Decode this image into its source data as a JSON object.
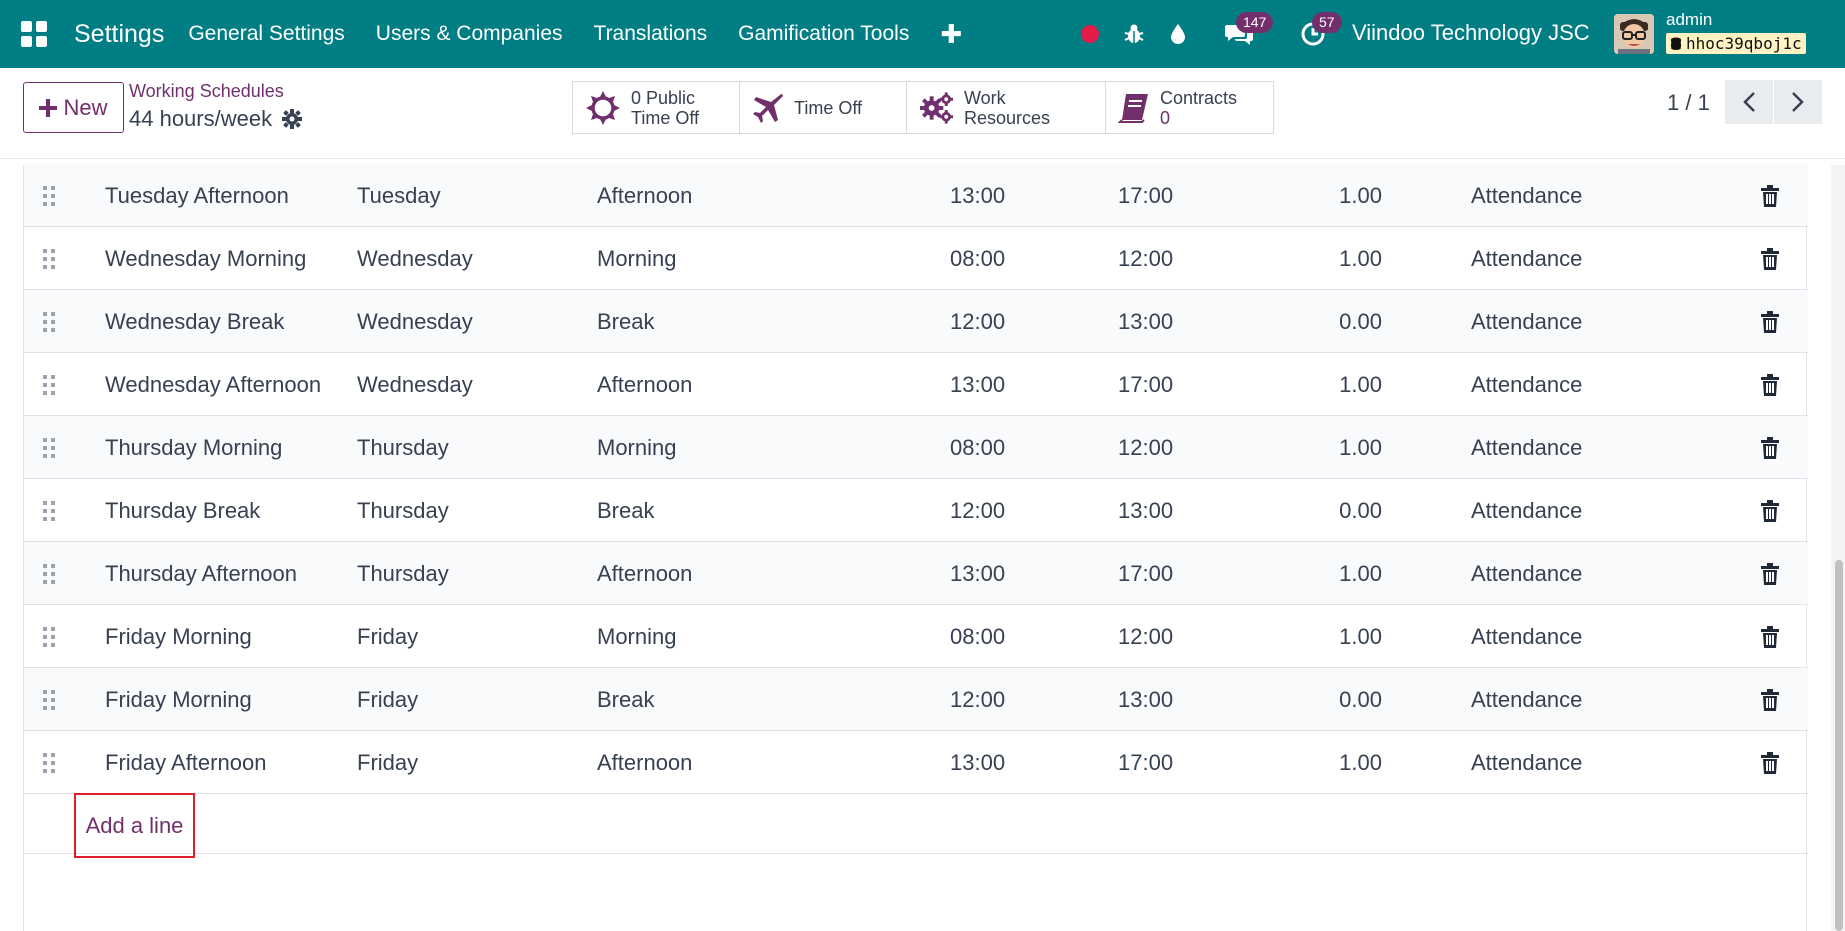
{
  "navbar": {
    "app_title": "Settings",
    "menus": [
      "General Settings",
      "Users & Companies",
      "Translations",
      "Gamification Tools"
    ],
    "plus_label": "✚",
    "messages_count": "147",
    "activities_count": "57",
    "company": "Viindoo Technology JSC",
    "user_name": "admin",
    "db_name": "hhoc39qboj1c",
    "colors": {
      "bar": "#017e84",
      "badge": "#71306b",
      "record_dot": "#e11d48"
    }
  },
  "control": {
    "new_label": "New",
    "breadcrumb": "Working Schedules",
    "record_name": "44 hours/week",
    "smart_buttons": [
      {
        "icon": "sun-icon",
        "line1": "0 Public",
        "line2": "Time Off"
      },
      {
        "icon": "plane-icon",
        "line1": "Time Off",
        "line2": ""
      },
      {
        "icon": "cogs-icon",
        "line1": "Work Resources",
        "line2": ""
      },
      {
        "icon": "book-icon",
        "line1": "Contracts",
        "line2": "0"
      }
    ],
    "pager": "1 / 1"
  },
  "list": {
    "rows": [
      {
        "name": "Tuesday Afternoon",
        "day": "Tuesday",
        "period": "Afternoon",
        "from": "13:00",
        "to": "17:00",
        "duration": "1.00",
        "type": "Attendance"
      },
      {
        "name": "Wednesday Morning",
        "day": "Wednesday",
        "period": "Morning",
        "from": "08:00",
        "to": "12:00",
        "duration": "1.00",
        "type": "Attendance"
      },
      {
        "name": "Wednesday Break",
        "day": "Wednesday",
        "period": "Break",
        "from": "12:00",
        "to": "13:00",
        "duration": "0.00",
        "type": "Attendance"
      },
      {
        "name": "Wednesday Afternoon",
        "day": "Wednesday",
        "period": "Afternoon",
        "from": "13:00",
        "to": "17:00",
        "duration": "1.00",
        "type": "Attendance"
      },
      {
        "name": "Thursday Morning",
        "day": "Thursday",
        "period": "Morning",
        "from": "08:00",
        "to": "12:00",
        "duration": "1.00",
        "type": "Attendance"
      },
      {
        "name": "Thursday Break",
        "day": "Thursday",
        "period": "Break",
        "from": "12:00",
        "to": "13:00",
        "duration": "0.00",
        "type": "Attendance"
      },
      {
        "name": "Thursday Afternoon",
        "day": "Thursday",
        "period": "Afternoon",
        "from": "13:00",
        "to": "17:00",
        "duration": "1.00",
        "type": "Attendance"
      },
      {
        "name": "Friday Morning",
        "day": "Friday",
        "period": "Morning",
        "from": "08:00",
        "to": "12:00",
        "duration": "1.00",
        "type": "Attendance"
      },
      {
        "name": "Friday Morning",
        "day": "Friday",
        "period": "Break",
        "from": "12:00",
        "to": "13:00",
        "duration": "0.00",
        "type": "Attendance"
      },
      {
        "name": "Friday Afternoon",
        "day": "Friday",
        "period": "Afternoon",
        "from": "13:00",
        "to": "17:00",
        "duration": "1.00",
        "type": "Attendance"
      }
    ],
    "add_line_label": "Add a line"
  }
}
